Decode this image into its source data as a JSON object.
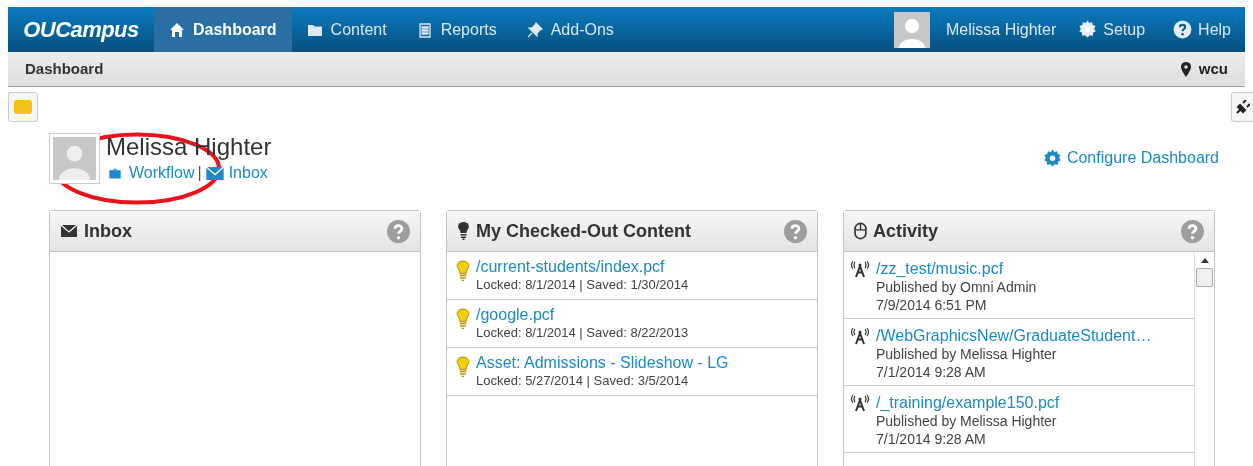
{
  "nav": {
    "logo": "OUCampus",
    "tabs": [
      {
        "label": "Dashboard",
        "selected": true
      },
      {
        "label": "Content",
        "selected": false
      },
      {
        "label": "Reports",
        "selected": false
      },
      {
        "label": "Add-Ons",
        "selected": false
      }
    ],
    "user": "Melissa Highter",
    "right": [
      "Setup",
      "Help"
    ]
  },
  "breadcrumb": {
    "title": "Dashboard",
    "site": "wcu"
  },
  "profile": {
    "name": "Melissa Highter",
    "links": [
      "Workflow",
      "Inbox"
    ],
    "separator": "|"
  },
  "configure": "Configure Dashboard",
  "panels": [
    {
      "title": "Inbox",
      "kind": "inbox"
    },
    {
      "title": "My Checked-Out Content",
      "kind": "checkout",
      "items": [
        {
          "link": "/current-students/index.pcf",
          "lines": [
            "Locked: 8/1/2014 | Saved: 1/30/2014"
          ]
        },
        {
          "link": "/google.pcf",
          "lines": [
            "Locked: 8/1/2014 | Saved: 8/22/2013"
          ]
        },
        {
          "link": "Asset: Admissions - Slideshow - LG",
          "lines": [
            "Locked: 5/27/2014 | Saved: 3/5/2014"
          ]
        }
      ]
    },
    {
      "title": "Activity",
      "kind": "activity",
      "items": [
        {
          "link": "/zz_test/music.pcf",
          "lines": [
            "Published by Omni Admin",
            "7/9/2014 6:51 PM"
          ]
        },
        {
          "link": "/WebGraphicsNew/GraduateStudent…",
          "lines": [
            "Published by Melissa Highter",
            "7/1/2014 9:28 AM"
          ]
        },
        {
          "link": "/_training/example150.pcf",
          "lines": [
            "Published by Melissa Highter",
            "7/1/2014 9:28 AM"
          ]
        }
      ]
    }
  ]
}
